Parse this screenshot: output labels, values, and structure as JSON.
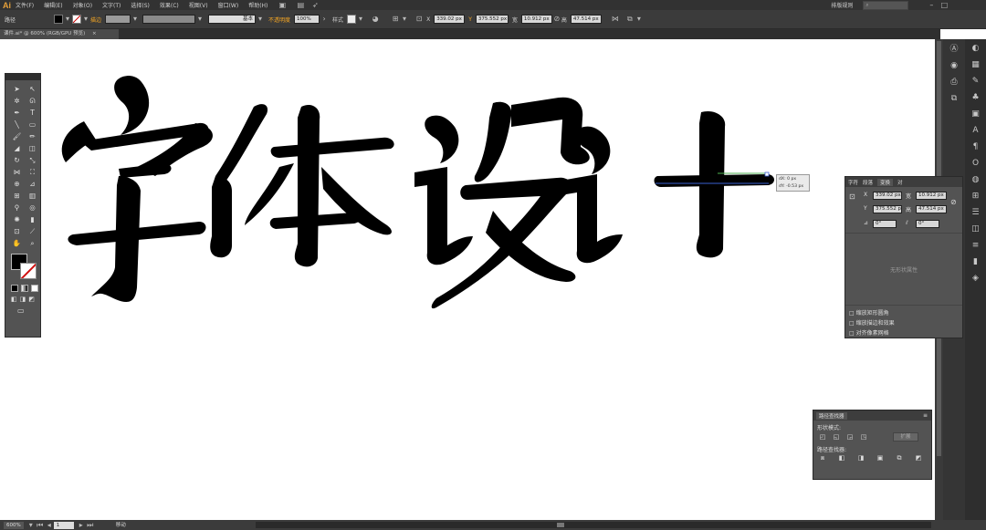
{
  "app": {
    "logo": "Ai"
  },
  "menu": [
    "文件(F)",
    "编辑(E)",
    "对象(O)",
    "文字(T)",
    "选择(S)",
    "效果(C)",
    "视图(V)",
    "窗口(W)",
    "帮助(H)"
  ],
  "workspace": {
    "label": "排版规则"
  },
  "control_bar": {
    "path_label": "路径",
    "stroke_label": "描边",
    "stroke_style_label": "基本",
    "opacity_label": "不透明度",
    "opacity_value": "100%",
    "style_label": "样式",
    "x_label": "X",
    "x_value": "339.02 px",
    "y_label": "Y",
    "y_value": "375.552 px",
    "w_label": "宽",
    "w_value": "10.912 px",
    "h_label": "高",
    "h_value": "47.514 px"
  },
  "document": {
    "tab_title": "课件.ai* @ 600% (RGB/GPU 预览)"
  },
  "artwork": {
    "text": "字体设计"
  },
  "tooltip": {
    "dx": "dX: 0 px",
    "dy": "dY: -0.53 px"
  },
  "transform_panel": {
    "tabs": [
      "字符",
      "段落",
      "变换",
      "对"
    ],
    "x_value": "339.02 px",
    "y_value": "375.552 px",
    "w_value": "10.912 px",
    "h_value": "47.514 px",
    "rotate_value": "0°",
    "shear_value": "0°",
    "no_shape_text": "无形状属性",
    "options": [
      "缩放矩形圆角",
      "缩放描边和效果",
      "对齐像素网格"
    ]
  },
  "pathfinder_panel": {
    "title": "路径查找器",
    "shape_modes_label": "形状模式:",
    "expand_label": "扩展",
    "pathfinders_label": "路径查找器:"
  },
  "status_bar": {
    "zoom": "600%",
    "page": "1",
    "tool": "移动"
  },
  "colors": {
    "accent": "#f5a623",
    "fill": "#000000",
    "stroke_none": "#d01010",
    "ui_dark": "#323232"
  }
}
